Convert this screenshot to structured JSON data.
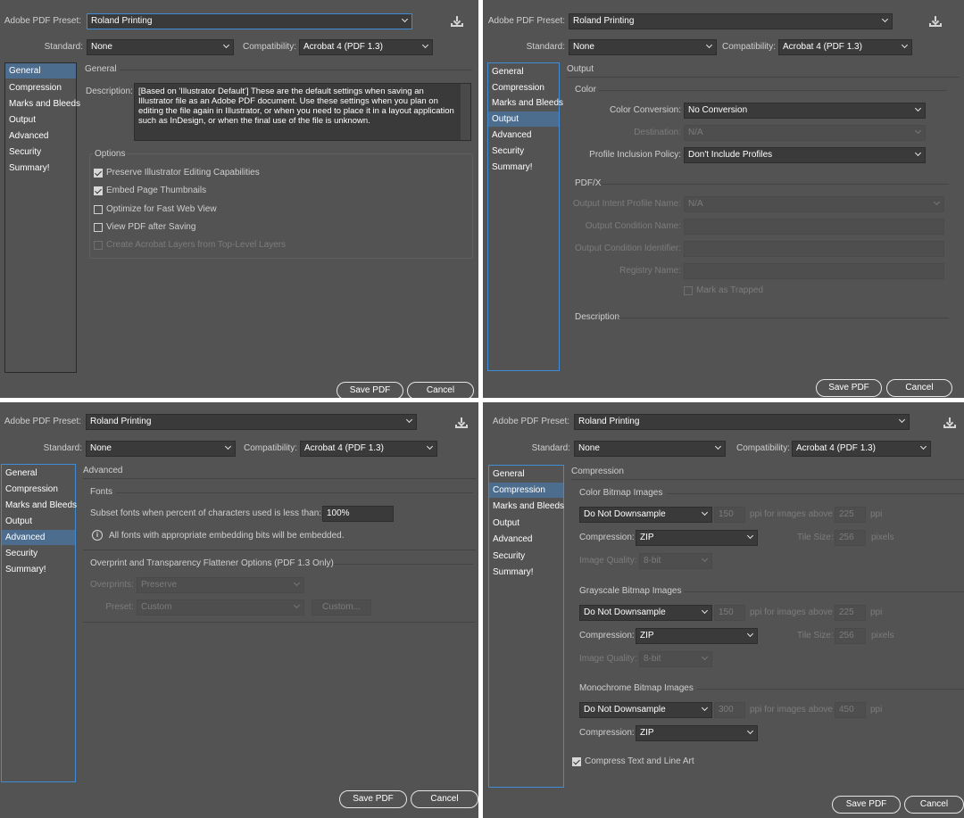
{
  "common": {
    "preset_label": "Adobe PDF Preset:",
    "preset_value": "Roland Printing",
    "standard_label": "Standard:",
    "standard_value": "None",
    "compat_label": "Compatibility:",
    "compat_value": "Acrobat 4 (PDF 1.3)",
    "save_label": "Save PDF",
    "cancel_label": "Cancel"
  },
  "sidebar": [
    "General",
    "Compression",
    "Marks and Bleeds",
    "Output",
    "Advanced",
    "Security",
    "Summary!"
  ],
  "general": {
    "title": "General",
    "description_label": "Description:",
    "description": "[Based on 'Illustrator Default'] These are the default settings when saving an Illustrator file as an Adobe PDF document. Use these settings when you plan on editing the file again in Illustrator, or when you need to place it in a layout application such as InDesign, or when the final use of the file is unknown.",
    "options_title": "Options",
    "options": [
      {
        "label": "Preserve Illustrator Editing Capabilities",
        "checked": true
      },
      {
        "label": "Embed Page Thumbnails",
        "checked": true
      },
      {
        "label": "Optimize for Fast Web View",
        "checked": false
      },
      {
        "label": "View PDF after Saving",
        "checked": false
      },
      {
        "label": "Create Acrobat Layers from Top-Level Layers",
        "checked": false,
        "disabled": true
      }
    ]
  },
  "output": {
    "title": "Output",
    "color_title": "Color",
    "color_conversion_label": "Color Conversion:",
    "color_conversion_value": "No Conversion",
    "destination_label": "Destination:",
    "destination_value": "N/A",
    "profile_label": "Profile Inclusion Policy:",
    "profile_value": "Don't Include Profiles",
    "pdfx_title": "PDF/X",
    "intent_label": "Output Intent Profile Name:",
    "intent_value": "N/A",
    "condition_name_label": "Output Condition Name:",
    "condition_id_label": "Output Condition Identifier:",
    "registry_label": "Registry Name:",
    "trapped_label": "Mark as Trapped",
    "description_title": "Description"
  },
  "advanced": {
    "title": "Advanced",
    "fonts_title": "Fonts",
    "subset_label": "Subset fonts when percent of characters used is less than:",
    "subset_value": "100%",
    "info_text": "All fonts with appropriate embedding bits will be embedded.",
    "overprint_title": "Overprint and Transparency Flattener Options (PDF 1.3 Only)",
    "overprints_label": "Overprints:",
    "overprints_value": "Preserve",
    "preset_label": "Preset:",
    "preset_value": "Custom",
    "custom_button": "Custom..."
  },
  "compression": {
    "title": "Compression",
    "color_title": "Color Bitmap Images",
    "gray_title": "Grayscale Bitmap Images",
    "mono_title": "Monochrome Bitmap Images",
    "downsample_value": "Do Not Downsample",
    "ppi_above_label": "ppi for images above",
    "ppi_label": "ppi",
    "compression_label": "Compression:",
    "compression_value": "ZIP",
    "tile_label": "Tile Size:",
    "tile_value": "256",
    "pixels_label": "pixels",
    "quality_label": "Image Quality:",
    "quality_value": "8-bit",
    "color_ppi": "150",
    "color_above": "225",
    "gray_ppi": "150",
    "gray_above": "225",
    "mono_ppi": "300",
    "mono_above": "450",
    "compress_text_label": "Compress Text and Line Art"
  }
}
